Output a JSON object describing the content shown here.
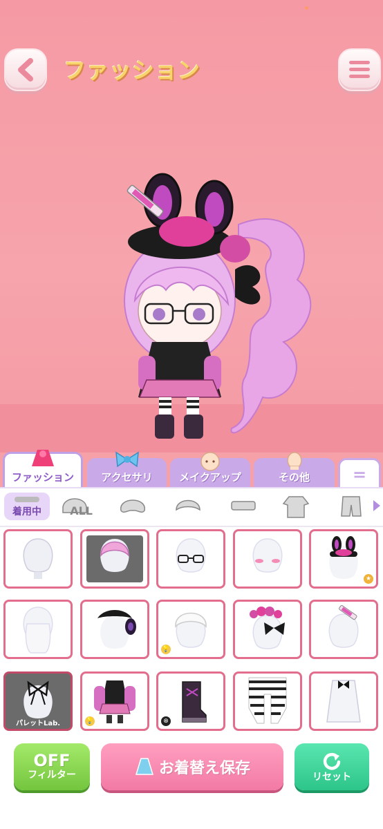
{
  "header": {
    "title": "ファッション",
    "back_icon": "chevron-left-icon",
    "menu_icon": "hamburger-menu-icon"
  },
  "tabs": [
    {
      "label": "ファッション",
      "icon": "dress-icon",
      "active": true
    },
    {
      "label": "アクセサリ",
      "icon": "ribbon-icon",
      "active": false
    },
    {
      "label": "メイクアップ",
      "icon": "face-icon",
      "active": false
    },
    {
      "label": "その他",
      "icon": "other-icon",
      "active": false
    },
    {
      "label": "=",
      "icon": "more-tab-icon",
      "active": false
    }
  ],
  "categories": {
    "wearing_label": "着用中",
    "all_label": "ALL",
    "items": [
      "wearing-icon",
      "all-icon",
      "hair-icon",
      "bangs-icon",
      "hat-icon",
      "jacket-icon",
      "pants-icon"
    ]
  },
  "items": [
    {
      "name": "item-blank-head"
    },
    {
      "name": "item-pink-hair",
      "selected": true
    },
    {
      "name": "item-glasses"
    },
    {
      "name": "item-blush"
    },
    {
      "name": "item-bunny-ears-hat"
    },
    {
      "name": "item-back-hair"
    },
    {
      "name": "item-black-headpiece"
    },
    {
      "name": "item-white-hair"
    },
    {
      "name": "item-pink-headband"
    },
    {
      "name": "item-syringe-hairpin"
    },
    {
      "name": "item-ribbon-choker",
      "selected": true,
      "label": "パレットLab."
    },
    {
      "name": "item-pink-jacket-outfit"
    },
    {
      "name": "item-black-boots"
    },
    {
      "name": "item-striped-socks"
    },
    {
      "name": "item-white-top"
    }
  ],
  "buttons": {
    "filter_state": "OFF",
    "filter_label": "フィルター",
    "save_label": "お着替え保存",
    "reset_label": "リセット"
  },
  "colors": {
    "background": "#f6a0a8",
    "tab_purple": "#c9a9e8",
    "cell_border": "#e26d8d",
    "filter_green": "#74c53e",
    "save_pink": "#f27aa4",
    "reset_teal": "#2dc589"
  }
}
